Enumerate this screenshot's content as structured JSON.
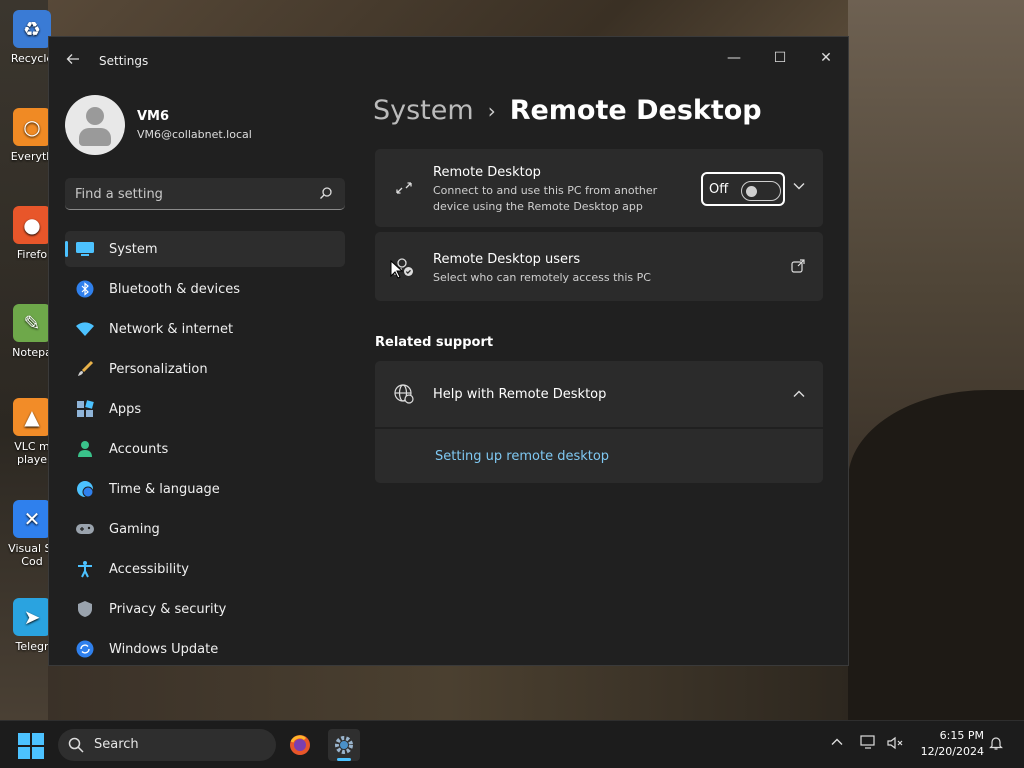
{
  "desktop": {
    "icons": [
      {
        "label": "Recycle",
        "color": "#3a7bd5",
        "glyph": "♻"
      },
      {
        "label": "Everyth",
        "color": "#f08a24",
        "glyph": "○"
      },
      {
        "label": "Firefo",
        "color": "#e8562a",
        "glyph": "●"
      },
      {
        "label": "Notepa",
        "color": "#6ea84a",
        "glyph": "✎"
      },
      {
        "label": "VLC m",
        "label2": "playe",
        "color": "#f28c28",
        "glyph": "▲"
      },
      {
        "label": "Visual St",
        "label2": "Cod",
        "color": "#2f80ed",
        "glyph": "✕"
      },
      {
        "label": "Telegr",
        "color": "#2aa3e0",
        "glyph": "➤"
      }
    ]
  },
  "window": {
    "title": "Settings",
    "back_icon": "back-arrow-icon",
    "minimize_label": "—",
    "maximize_label": "☐",
    "close_label": "✕"
  },
  "profile": {
    "name": "VM6",
    "email": "VM6@collabnet.local"
  },
  "search": {
    "placeholder": "Find a setting"
  },
  "nav": {
    "items": [
      {
        "label": "System",
        "icon": "monitor-icon",
        "color": "#4cc2ff",
        "active": true
      },
      {
        "label": "Bluetooth & devices",
        "icon": "bluetooth-icon",
        "color": "#2f80ed"
      },
      {
        "label": "Network & internet",
        "icon": "wifi-icon",
        "color": "#4cc2ff"
      },
      {
        "label": "Personalization",
        "icon": "brush-icon",
        "color": "#e8b24a"
      },
      {
        "label": "Apps",
        "icon": "apps-icon",
        "color": "#8fb4d8"
      },
      {
        "label": "Accounts",
        "icon": "person-icon",
        "color": "#3ac28a"
      },
      {
        "label": "Time & language",
        "icon": "globe-clock-icon",
        "color": "#4cc2ff"
      },
      {
        "label": "Gaming",
        "icon": "gamepad-icon",
        "color": "#9aa3ad"
      },
      {
        "label": "Accessibility",
        "icon": "accessibility-icon",
        "color": "#4cc2ff"
      },
      {
        "label": "Privacy & security",
        "icon": "shield-icon",
        "color": "#9aa3ad"
      },
      {
        "label": "Windows Update",
        "icon": "update-icon",
        "color": "#2f80ed"
      }
    ]
  },
  "breadcrumb": {
    "parent": "System",
    "separator": "›",
    "current": "Remote Desktop"
  },
  "remote_desktop": {
    "title": "Remote Desktop",
    "subtitle_line1": "Connect to and use this PC from another",
    "subtitle_line2": "device using the Remote Desktop app",
    "toggle_label": "Off",
    "toggle_on": false
  },
  "remote_users": {
    "title": "Remote Desktop users",
    "subtitle": "Select who can remotely access this PC"
  },
  "related_support": {
    "heading": "Related support",
    "help_title": "Help with Remote Desktop",
    "link": "Setting up remote desktop"
  },
  "taskbar": {
    "search_label": "Search",
    "time": "6:15 PM",
    "date": "12/20/2024",
    "accent": "#4cc2ff"
  }
}
